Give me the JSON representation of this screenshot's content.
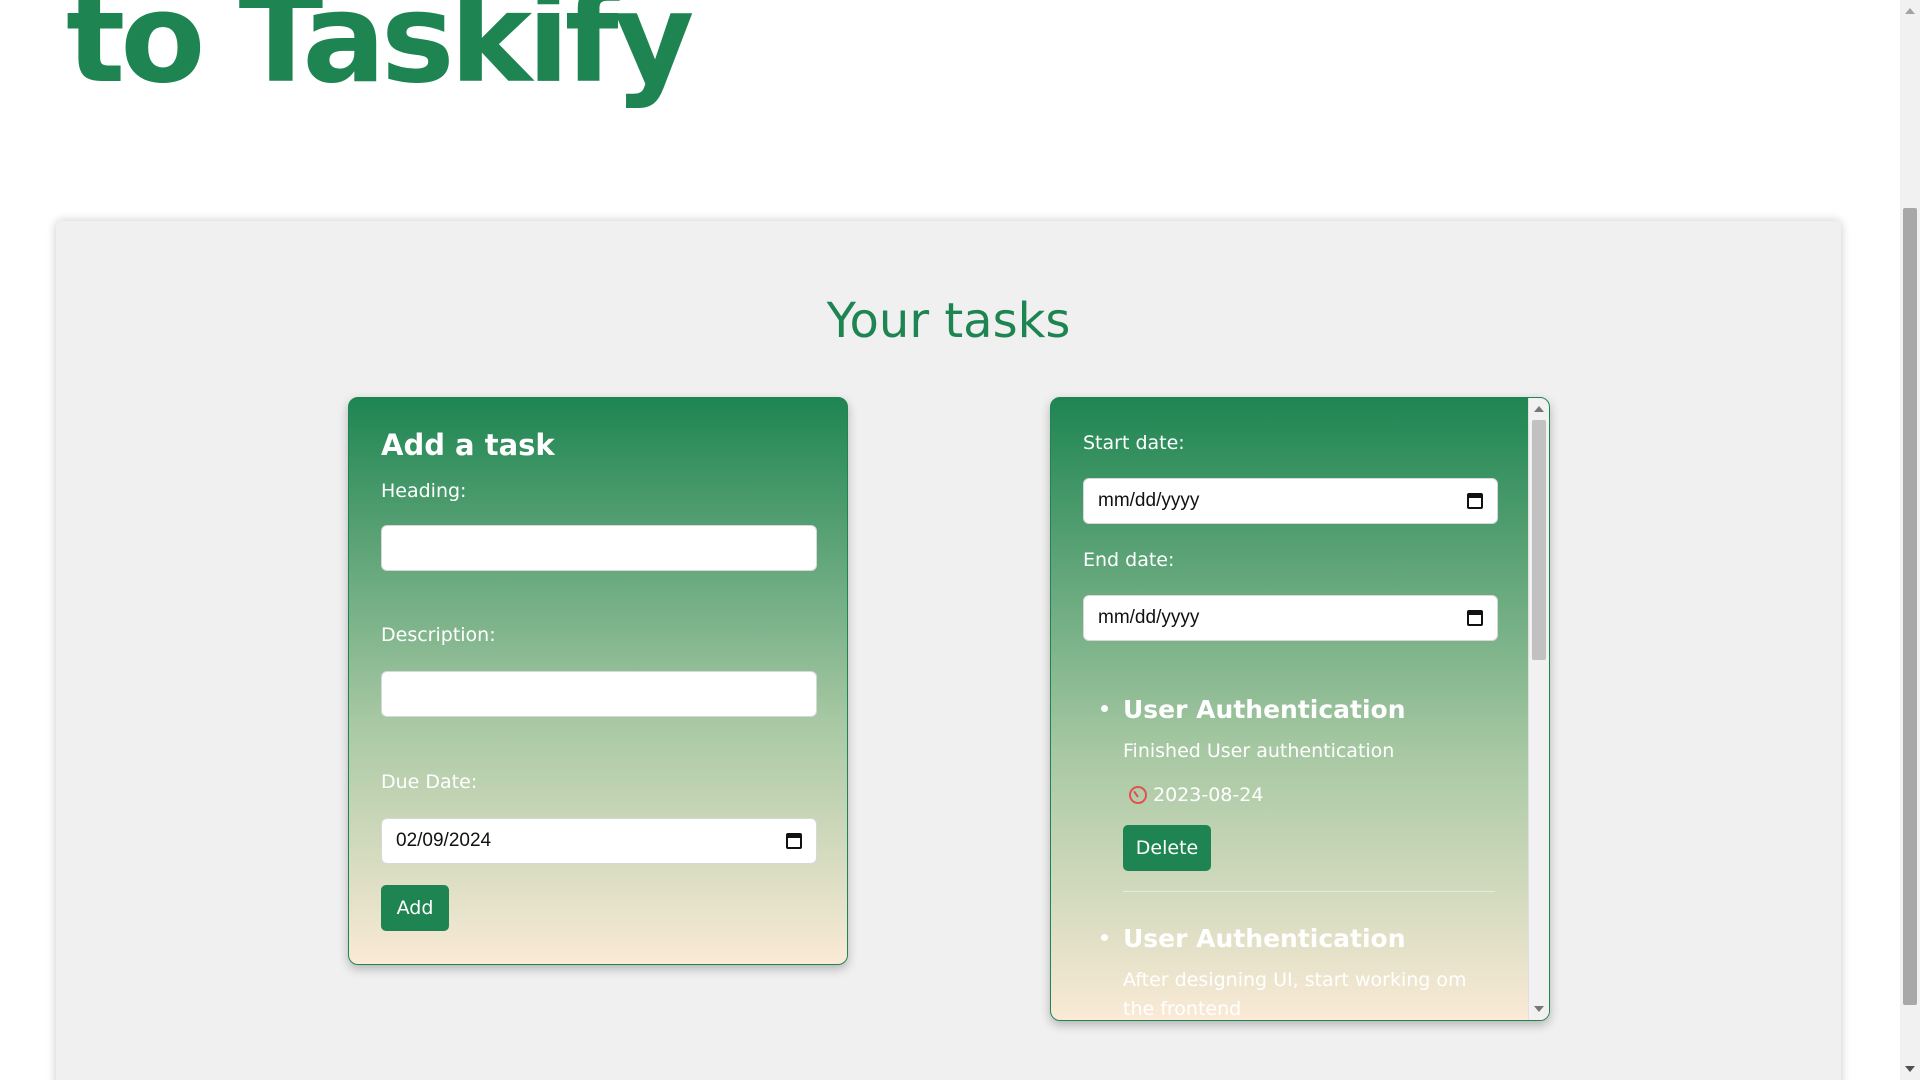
{
  "hero": {
    "title": "to Taskify"
  },
  "tasks_section": {
    "title": "Your tasks"
  },
  "add_task": {
    "heading": "Add a task",
    "heading_label": "Heading:",
    "heading_value": "",
    "description_label": "Description:",
    "description_value": "",
    "due_date_label": "Due Date:",
    "due_date_value": "02/09/2024",
    "add_label": "Add"
  },
  "filters": {
    "start_date_label": "Start date:",
    "start_date_value": "mm/dd/yyyy",
    "end_date_label": "End date:",
    "end_date_value": "mm/dd/yyyy"
  },
  "tasks": [
    {
      "title": "User Authentication",
      "description": "Finished User authentication",
      "date": "2023-08-24",
      "delete_label": "Delete"
    },
    {
      "title": "User Authentication",
      "description": "After designing UI, start working om the frontend"
    }
  ],
  "colors": {
    "brand_green": "#1e8552",
    "card_bottom": "#faead6",
    "timer_red": "#e05252",
    "section_bg": "#f0f0f0"
  },
  "icons": {
    "calendar": "calendar-icon",
    "timer": "timer-icon"
  }
}
